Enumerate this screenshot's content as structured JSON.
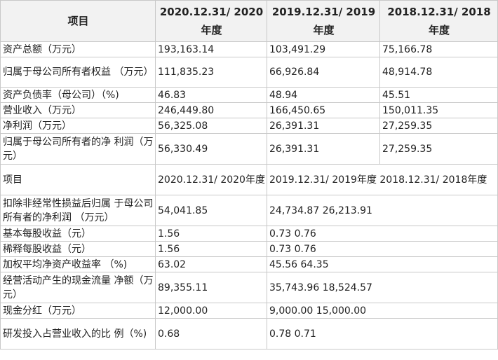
{
  "header": {
    "item": "项目",
    "col1": "2020.12.31/ 2020年度",
    "col2": "2019.12.31/ 2019年度",
    "col3": "2018.12.31/ 2018年度"
  },
  "rows_top": [
    {
      "label": "资产总额（万元）",
      "v1": "193,163.14",
      "v2": "103,491.29",
      "v3": "75,166.78"
    },
    {
      "label": "归属于母公司所有者权益 （万元）",
      "v1": "111,835.23",
      "v2": "66,926.84",
      "v3": "48,914.78"
    },
    {
      "label": "资产负债率（母公司）（%)",
      "v1": "46.83",
      "v2": "48.94",
      "v3": "45.51"
    },
    {
      "label": "营业收入（万元）",
      "v1": "246,449.80",
      "v2": "166,450.65",
      "v3": "150,011.35"
    },
    {
      "label": "净利润（万元）",
      "v1": "56,325.08",
      "v2": "26,391.31",
      "v3": "27,259.35"
    },
    {
      "label": "归属于母公司所有者的净 利润（万元）",
      "v1": "56,330.49",
      "v2": "26,391.31",
      "v3": "27,259.35"
    }
  ],
  "mid_header": {
    "item": "项目",
    "col1": "2020.12.31/ 2020年度",
    "col23": "2019.12.31/ 2019年度 2018.12.31/ 2018年度"
  },
  "rows_bottom": [
    {
      "label": "扣除非经常性损益后归属 于母公司所有者的净利润 （万元）",
      "v1": "54,041.85",
      "v23": "24,734.87 26,213.91"
    },
    {
      "label": "基本每股收益（元）",
      "v1": "1.56",
      "v23": "0.73 0.76"
    },
    {
      "label": "稀释每股收益（元）",
      "v1": "1.56",
      "v23": "0.73 0.76"
    },
    {
      "label": "加权平均净资产收益率 （%)",
      "v1": "63.02",
      "v23": "45.56 64.35"
    },
    {
      "label": "经营活动产生的现金流量 净额（万元）",
      "v1": "89,355.11",
      "v23": "35,743.96 18,524.57"
    },
    {
      "label": "现金分红（万元）",
      "v1": "12,000.00",
      "v23": "9,000.00 15,000.00"
    },
    {
      "label": "研发投入占营业收入的比 例（%)",
      "v1": "0.68",
      "v23": "0.78 0.71"
    }
  ]
}
